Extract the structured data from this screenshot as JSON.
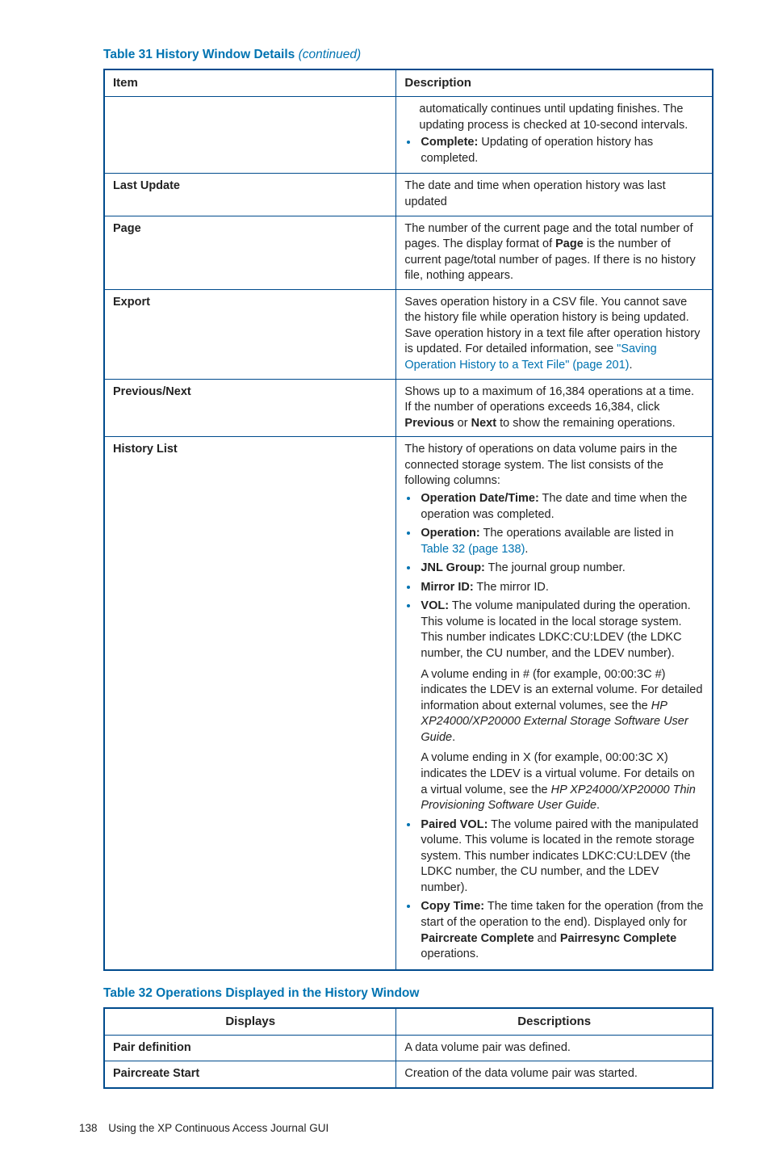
{
  "table31": {
    "title_prefix": "Table 31 History Window Details ",
    "title_suffix": "(continued)",
    "headers": {
      "item": "Item",
      "description": "Description"
    },
    "row_cont": {
      "p1": "automatically continues until updating finishes. The updating process is checked at 10-second intervals.",
      "b1_label": "Complete:",
      "b1_text": " Updating of operation history has completed."
    },
    "row_last_update": {
      "item": "Last Update",
      "desc": "The date and time when operation history was last updated"
    },
    "row_page": {
      "item": "Page",
      "p1a": "The number of the current page and the total number of pages. The display format of ",
      "p1b": "Page",
      "p1c": " is the number of current page/total number of pages. If there is no history file, nothing appears."
    },
    "row_export": {
      "item": "Export",
      "p1": "Saves operation history in a CSV file. You cannot save the history file while operation history is being updated. Save operation history in a text file after operation history is updated. For detailed information, see ",
      "link": "\"Saving Operation History to a Text File\" (page 201)",
      "tail": "."
    },
    "row_prevnext": {
      "item": "Previous/Next",
      "p1a": "Shows up to a maximum of 16,384 operations at a time. If the number of operations exceeds 16,384, click ",
      "p1b": "Previous",
      "p1c": " or ",
      "p1d": "Next",
      "p1e": " to show the remaining operations."
    },
    "row_history": {
      "item": "History List",
      "intro": "The history of operations on data volume pairs in the connected storage system. The list consists of the following columns:",
      "b1_label": "Operation Date/Time:",
      "b1_text": " The date and time when the operation was completed.",
      "b2_label": "Operation:",
      "b2_text": " The operations available are listed in ",
      "b2_link": "Table 32 (page 138)",
      "b2_tail": ".",
      "b3_label": "JNL Group:",
      "b3_text": " The journal group number.",
      "b4_label": "Mirror ID:",
      "b4_text": " The mirror ID.",
      "b5_label": "VOL:",
      "b5_text": " The volume manipulated during the operation. This volume is located in the local storage system. This number indicates LDKC:CU:LDEV (the LDKC number, the CU number, and the LDEV number).",
      "b5_p2a": "A volume ending in # (for example, 00:00:3C #) indicates the LDEV is an external volume. For detailed information about external volumes, see the ",
      "b5_p2b": "HP XP24000/XP20000 External Storage Software User Guide",
      "b5_p2c": ".",
      "b5_p3a": "A volume ending in X (for example, 00:00:3C X) indicates the LDEV is a virtual volume. For details on a virtual volume, see the ",
      "b5_p3b": "HP XP24000/XP20000 Thin Provisioning Software User Guide",
      "b5_p3c": ".",
      "b6_label": "Paired VOL:",
      "b6_text": " The volume paired with the manipulated volume. This volume is located in the remote storage system. This number indicates LDKC:CU:LDEV (the LDKC number, the CU number, and the LDEV number).",
      "b7_label": "Copy Time:",
      "b7_text_a": " The time taken for the operation (from the start of the operation to the end). Displayed only for ",
      "b7_text_b": "Paircreate Complete",
      "b7_text_c": " and ",
      "b7_text_d": "Pairresync Complete",
      "b7_text_e": " operations."
    }
  },
  "table32": {
    "title": "Table 32 Operations Displayed in the History Window",
    "headers": {
      "displays": "Displays",
      "descriptions": "Descriptions"
    },
    "rows": [
      {
        "d": "Pair definition",
        "desc": "A data volume pair was defined."
      },
      {
        "d": "Paircreate Start",
        "desc": "Creation of the data volume pair was started."
      }
    ]
  },
  "footer": {
    "page": "138",
    "section": "Using the XP Continuous Access Journal GUI"
  }
}
